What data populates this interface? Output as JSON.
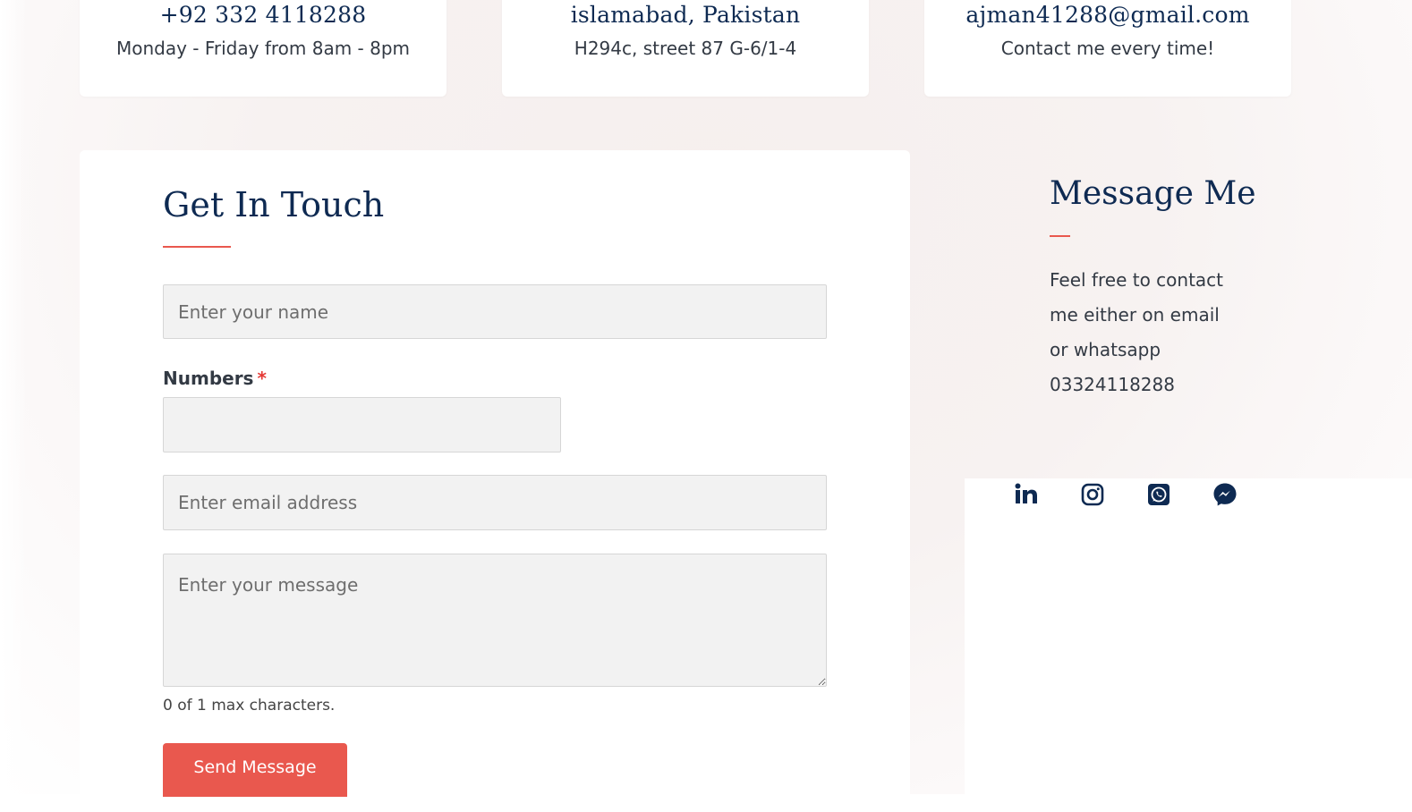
{
  "contact_cards": [
    {
      "title": "+92 332 4118288",
      "subtitle": "Monday - Friday from 8am - 8pm"
    },
    {
      "title": "islamabad, Pakistan",
      "subtitle": "H294c, street 87 G-6/1-4"
    },
    {
      "title": "ajman41288@gmail.com",
      "subtitle": "Contact me every time!"
    }
  ],
  "form": {
    "title": "Get In Touch",
    "name_placeholder": "Enter your name",
    "numbers_label": "Numbers",
    "required_mark": "*",
    "numbers_value": "",
    "email_placeholder": "Enter email address",
    "message_placeholder": "Enter your message",
    "char_counter": "0 of 1 max characters.",
    "submit_label": "Send Message"
  },
  "sidebar": {
    "title": "Message Me",
    "text": "Feel free to contact me either on email or whatsapp 03324118288",
    "social_icons": [
      "linkedin-icon",
      "instagram-icon",
      "whatsapp-icon",
      "messenger-icon"
    ]
  },
  "colors": {
    "navy": "#0e2a52",
    "accent": "#e9584e",
    "text": "#333a44",
    "field_bg": "#f2f2f2"
  }
}
